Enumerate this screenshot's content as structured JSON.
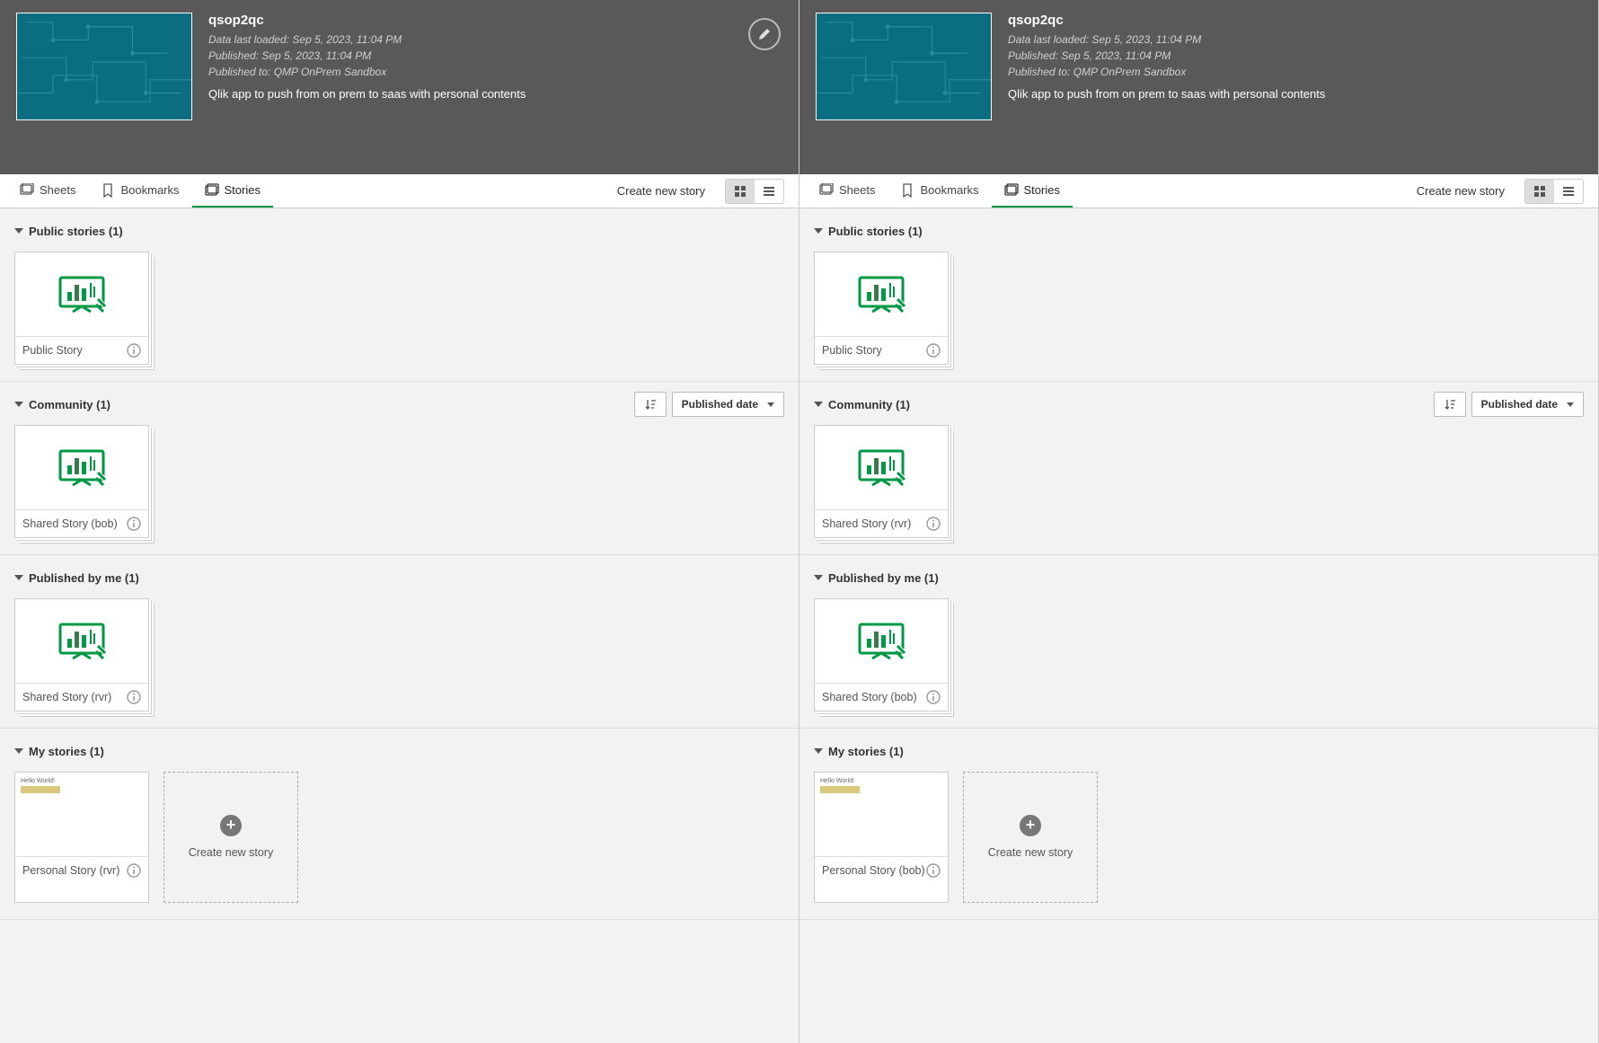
{
  "app": {
    "title": "qsop2qc",
    "meta_loaded": "Data last loaded: Sep 5, 2023, 11:04 PM",
    "meta_published": "Published: Sep 5, 2023, 11:04 PM",
    "meta_published_to": "Published to: QMP OnPrem Sandbox",
    "description": "Qlik app to push from on prem to saas with personal contents"
  },
  "tabs": {
    "sheets": "Sheets",
    "bookmarks": "Bookmarks",
    "stories": "Stories",
    "create_new": "Create new story"
  },
  "sort": {
    "label": "Published date"
  },
  "left": {
    "sections": {
      "public": {
        "heading": "Public stories (1)",
        "card1": "Public Story"
      },
      "community": {
        "heading": "Community (1)",
        "card1": "Shared Story (bob)"
      },
      "published_by_me": {
        "heading": "Published by me (1)",
        "card1": "Shared Story (rvr)"
      },
      "my_stories": {
        "heading": "My stories (1)",
        "card1": "Personal Story (rvr)",
        "hello": "Hello World!"
      }
    }
  },
  "right": {
    "sections": {
      "public": {
        "heading": "Public stories (1)",
        "card1": "Public Story"
      },
      "community": {
        "heading": "Community (1)",
        "card1": "Shared Story (rvr)"
      },
      "published_by_me": {
        "heading": "Published by me (1)",
        "card1": "Shared Story (bob)"
      },
      "my_stories": {
        "heading": "My stories (1)",
        "card1": "Personal Story (bob)",
        "hello": "Hello World!"
      }
    }
  },
  "create_card": "Create new story"
}
